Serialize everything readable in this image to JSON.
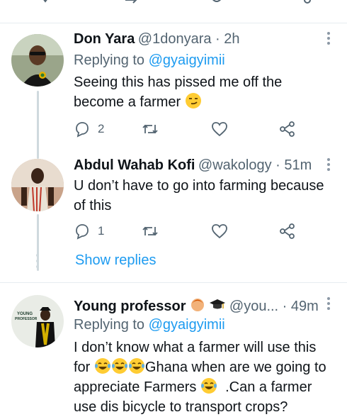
{
  "colors": {
    "link": "#1d9bf0",
    "muted": "#536471",
    "text": "#0f1419",
    "divider": "#e6ecf0"
  },
  "tweets": [
    {
      "name": "Don Yara",
      "handle": "@1donyara",
      "time": "2h",
      "replying_label": "Replying to",
      "replying_handle": "@gyaigyimii",
      "lines": [
        "Seeing this has pissed me off the",
        "become a farmer"
      ],
      "emoji": "smirk",
      "replies": "2"
    },
    {
      "name": "Abdul Wahab Kofi",
      "handle": "@wakology",
      "time": "51m",
      "lines": [
        "U don’t have to go into farming because",
        "of this"
      ],
      "replies": "1"
    },
    {
      "name": "Young professor",
      "handle": "@you...",
      "time": "49m",
      "replying_label": "Replying to",
      "replying_handle": "@gyaigyimii",
      "line1": "I don’t know what a farmer will use this",
      "line2_pre": "for",
      "line2_post": "Ghana when are we going to",
      "line3_pre": "appreciate Farmers",
      "line3_post": ".Can a farmer",
      "line4": "use dis bicycle to transport crops?",
      "avatar_text_1": "YOUNG",
      "avatar_text_2": "PROFESSOR"
    }
  ],
  "show_replies": "Show replies",
  "dot": " · "
}
